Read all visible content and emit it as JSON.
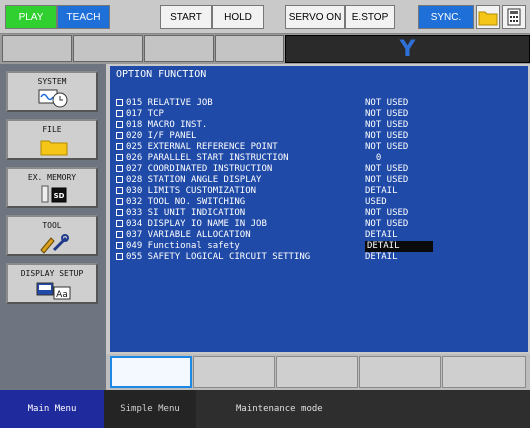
{
  "topbar": {
    "play": "PLAY",
    "teach": "TEACH",
    "start": "START",
    "hold": "HOLD",
    "servo_on": "SERVO ON",
    "estop": "E.STOP",
    "sync": "SYNC."
  },
  "tabrow": {
    "active_label": "Y"
  },
  "left_menu": [
    {
      "label": "SYSTEM",
      "icon": "system-clock-icon"
    },
    {
      "label": "FILE",
      "icon": "folder-icon"
    },
    {
      "label": "EX. MEMORY",
      "icon": "sd-card-icon"
    },
    {
      "label": "TOOL",
      "icon": "tools-icon"
    },
    {
      "label": "DISPLAY SETUP",
      "icon": "display-icon"
    }
  ],
  "main": {
    "title": "OPTION FUNCTION",
    "options": [
      {
        "name": "015 RELATIVE JOB",
        "value": "NOT USED"
      },
      {
        "name": "017 TCP",
        "value": "NOT USED"
      },
      {
        "name": "018 MACRO INST.",
        "value": "NOT USED"
      },
      {
        "name": "020 I/F PANEL",
        "value": "NOT USED"
      },
      {
        "name": "025 EXTERNAL REFERENCE POINT",
        "value": "NOT USED"
      },
      {
        "name": "026 PARALLEL START INSTRUCTION",
        "value": "  0"
      },
      {
        "name": "027 COORDINATED INSTRUCTION",
        "value": "NOT USED"
      },
      {
        "name": "028 STATION ANGLE DISPLAY",
        "value": "NOT USED"
      },
      {
        "name": "030 LIMITS CUSTOMIZATION",
        "value": "DETAIL"
      },
      {
        "name": "032 TOOL NO. SWITCHING",
        "value": "USED"
      },
      {
        "name": "033 SI UNIT INDICATION",
        "value": "NOT USED"
      },
      {
        "name": "034 DISPLAY IO NAME IN JOB",
        "value": "NOT USED"
      },
      {
        "name": "037 VARIABLE ALLOCATION",
        "value": "DETAIL"
      },
      {
        "name": "049 Functional safety",
        "value": "DETAIL"
      },
      {
        "name": "055 SAFETY LOGICAL CIRCUIT SETTING",
        "value": "DETAIL"
      }
    ]
  },
  "statusbar": {
    "main_menu": "Main Menu",
    "simple_menu": "Simple Menu",
    "mode": "Maintenance mode"
  },
  "colors": {
    "play": "#2fd02f",
    "teach": "#1f6fd8",
    "panel_blue": "#1f4aa8",
    "status_blue": "#1f2a9c"
  }
}
